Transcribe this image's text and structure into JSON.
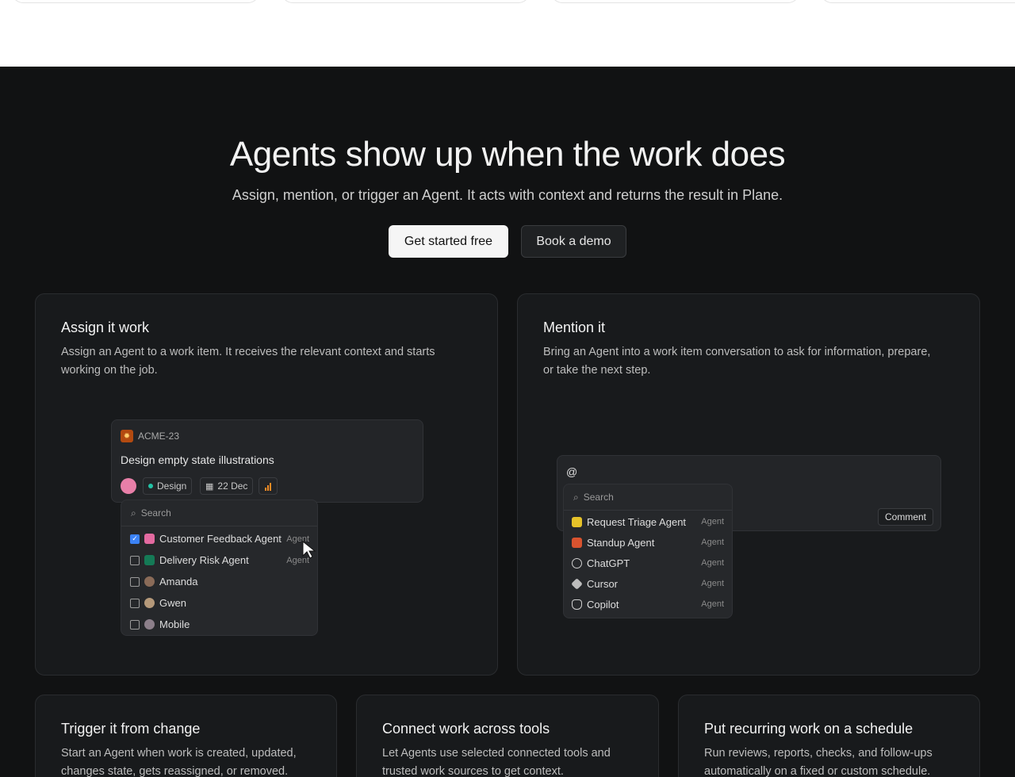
{
  "hero": {
    "title": "Agents show up when the work does",
    "subtitle": "Assign, mention, or trigger an Agent. It acts with context and returns the result in Plane.",
    "primary_cta": "Get started free",
    "secondary_cta": "Book a demo"
  },
  "cards": {
    "assign": {
      "title": "Assign it work",
      "desc_line1": "Assign an Agent to a work item. It receives the relevant context and starts",
      "desc_line2": "working on the job."
    },
    "mention": {
      "title": "Mention it",
      "desc_line1": "Bring an Agent into a work item conversation to ask for information, prepare,",
      "desc_line2": "or take the next step."
    },
    "trigger": {
      "title": "Trigger it from change",
      "desc_line1": "Start an Agent when work is created, updated,",
      "desc_line2": "changes state, gets reassigned, or removed."
    },
    "connect": {
      "title": "Connect work across tools",
      "desc_line1": "Let Agents use selected connected tools and",
      "desc_line2": "trusted work sources to get context."
    },
    "schedule": {
      "title": "Put recurring work on a schedule",
      "desc_line1": "Run reviews, reports, checks, and follow-ups",
      "desc_line2": "automatically on a fixed or custom schedule."
    }
  },
  "assign_mock": {
    "issue_id": "ACME-23",
    "issue_title": "Design empty state illustrations",
    "label": "Design",
    "date": "22 Dec",
    "search_placeholder": "Search",
    "options": [
      {
        "name": "Customer Feedback Agent",
        "tag": "Agent",
        "checked": true
      },
      {
        "name": "Delivery Risk Agent",
        "tag": "Agent",
        "checked": false
      },
      {
        "name": "Amanda",
        "tag": "",
        "checked": false
      },
      {
        "name": "Gwen",
        "tag": "",
        "checked": false
      },
      {
        "name": "Mobile",
        "tag": "",
        "checked": false
      }
    ]
  },
  "mention_mock": {
    "at_symbol": "@",
    "search_placeholder": "Search",
    "comment_button": "Comment",
    "options": [
      {
        "name": "Request Triage Agent",
        "tag": "Agent"
      },
      {
        "name": "Standup Agent",
        "tag": "Agent"
      },
      {
        "name": "ChatGPT",
        "tag": "Agent"
      },
      {
        "name": "Cursor",
        "tag": "Agent"
      },
      {
        "name": "Copilot",
        "tag": "Agent"
      }
    ]
  },
  "colors": {
    "background": "#111213",
    "card": "#181a1c",
    "accent_check": "#3b82f6",
    "label_dot": "#22c3a6",
    "priority": "#f08a24"
  }
}
